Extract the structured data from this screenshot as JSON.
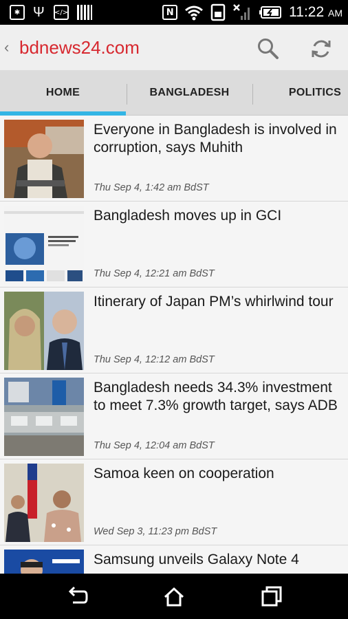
{
  "status_bar": {
    "time": "11:22",
    "ampm": "AM"
  },
  "app_bar": {
    "title": "bdnews24.com",
    "accent_color": "#d7282f"
  },
  "tabs": [
    {
      "label": "HOME",
      "selected": true
    },
    {
      "label": "BANGLADESH",
      "selected": false
    },
    {
      "label": "POLITICS",
      "selected": false
    }
  ],
  "tab_indicator_color": "#33b5e5",
  "articles": [
    {
      "headline": "Everyone in Bangladesh is involved in corruption, says Muhith",
      "date": "Thu Sep 4, 1:42 am BdST"
    },
    {
      "headline": "Bangladesh moves up in GCI",
      "date": "Thu Sep 4, 12:21 am BdST"
    },
    {
      "headline": "Itinerary of Japan PM’s whirlwind tour",
      "date": "Thu Sep 4, 12:12 am BdST"
    },
    {
      "headline": "Bangladesh needs 34.3% investment to meet 7.3% growth target, says ADB",
      "date": "Thu Sep 4, 12:04 am BdST"
    },
    {
      "headline": "Samoa keen on cooperation",
      "date": "Wed Sep 3, 11:23 pm BdST"
    },
    {
      "headline": "Samsung unveils Galaxy Note 4",
      "date": ""
    }
  ]
}
